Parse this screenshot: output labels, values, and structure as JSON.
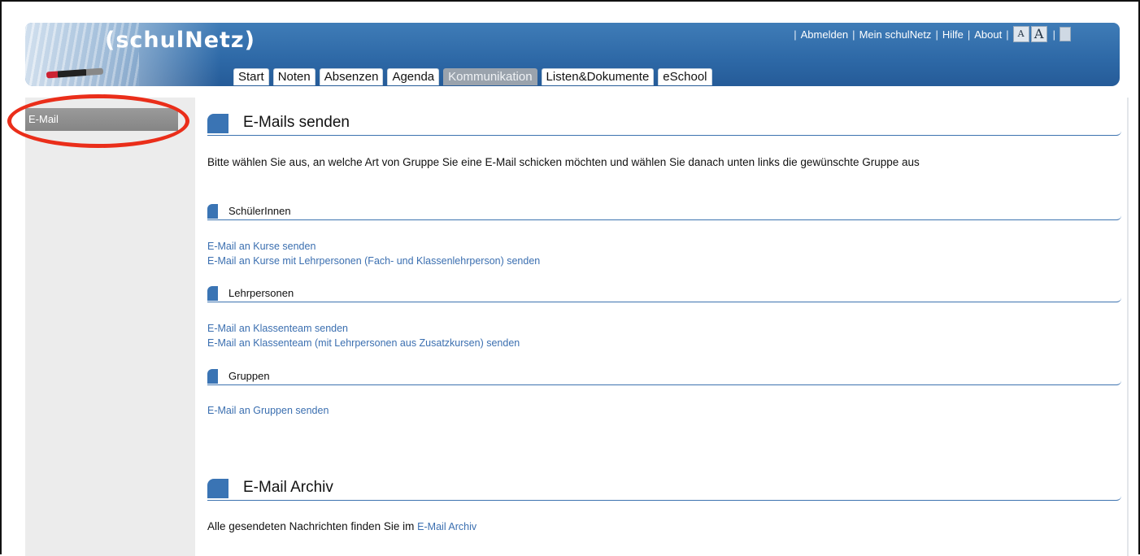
{
  "header": {
    "logo_text": "(schulNetz)",
    "links": [
      "Abmelden",
      "Mein schulNetz",
      "Hilfe",
      "About"
    ],
    "font_small": "A",
    "font_large": "A",
    "tabs": [
      {
        "label": "Start",
        "active": false
      },
      {
        "label": "Noten",
        "active": false
      },
      {
        "label": "Absenzen",
        "active": false
      },
      {
        "label": "Agenda",
        "active": false
      },
      {
        "label": "Kommunikation",
        "active": true
      },
      {
        "label": "Listen&Dokumente",
        "active": false
      },
      {
        "label": "eSchool",
        "active": false
      }
    ]
  },
  "sidebar": {
    "items": [
      {
        "label": "E-Mail",
        "selected": true
      }
    ]
  },
  "main": {
    "send_title": "E-Mails senden",
    "intro": "Bitte wählen Sie aus, an welche Art von Gruppe Sie eine E-Mail schicken möchten und wählen Sie danach unten links die gewünschte Gruppe aus",
    "groups": [
      {
        "title": "SchülerInnen",
        "links": [
          "E-Mail an Kurse senden",
          "E-Mail an Kurse mit Lehrpersonen (Fach- und Klassenlehrperson) senden"
        ]
      },
      {
        "title": "Lehrpersonen",
        "links": [
          "E-Mail an Klassenteam senden",
          "E-Mail an Klassenteam (mit Lehrpersonen aus Zusatzkursen) senden"
        ]
      },
      {
        "title": "Gruppen",
        "links": [
          "E-Mail an Gruppen senden"
        ]
      }
    ],
    "archive_title": "E-Mail Archiv",
    "archive_text": "Alle gesendeten Nachrichten finden Sie im",
    "archive_link": "E-Mail Archiv"
  },
  "colors": {
    "header_blue": "#2d68a6",
    "link_blue": "#3b6fb0",
    "active_tab": "#9aa3ad",
    "highlight_red": "#ea2e1a"
  }
}
